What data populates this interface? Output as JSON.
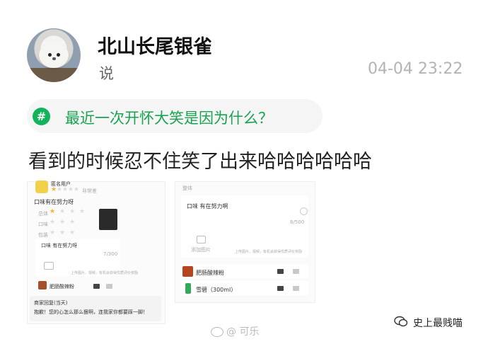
{
  "post": {
    "username": "北山长尾银雀",
    "said": "说",
    "timestamp": "04-04 23:22",
    "topic": "最近一次开怀大笑是因为什么？",
    "topic_icon": "#",
    "text": "看到的时候忍不住笑了出来哈哈哈哈哈哈"
  },
  "left_screenshot": {
    "shop_name": "匿名用户",
    "rating_label": "非常差",
    "review": "口味有在努力呀",
    "row_labels": [
      "总体",
      "口味",
      "包装",
      "分量"
    ],
    "input_text": "口味 有在努力呀",
    "counter": "7/300",
    "upload_hint": "上传图片、视频，有机会获得优质评价奖励",
    "dish": "肥肠酸辣粉",
    "reply_title": "商家回复(当天)",
    "reply_text": "抱歉！您的心怎么那么狠啊，连我家你都要踩一脚！"
  },
  "right_screenshot": {
    "header": "整体",
    "review": "口味 有在努力啊",
    "counter": "8/500",
    "add_photo": "添加图片",
    "upload_hint": "上传图片、视频，有机会获得优质评价奖励",
    "dishes": [
      "肥肠酸辣粉",
      "雪碧（300ml）"
    ]
  },
  "watermarks": {
    "weibo": "@ 可乐",
    "account": "史上最贱喵"
  },
  "colors": {
    "topic_green": "#18a351",
    "timestamp_grey": "#b3b3b3"
  },
  "icons": [
    "topic-hashtag-icon",
    "camera-icon",
    "thumb-down-icon",
    "thumb-up-icon",
    "weibo-icon",
    "wechat-icon"
  ]
}
